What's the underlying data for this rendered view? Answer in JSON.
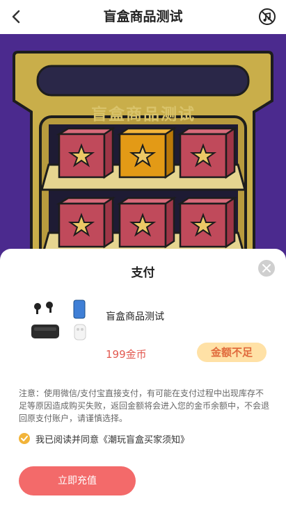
{
  "header": {
    "title": "盲盒商品测试",
    "back_icon": "chevron-left-icon",
    "music_icon": "music-off-icon"
  },
  "scene": {
    "sign_text": "盲盒商品测试",
    "colors": {
      "background": "#4b2a8e",
      "cabinet": "#c9ae4a",
      "box_pink": "#c04a5b",
      "box_orange": "#e39a16"
    }
  },
  "modal": {
    "title": "支付",
    "close_icon": "close-icon",
    "product": {
      "name": "盲盒商品测试",
      "price": "199金币",
      "status": "金额不足"
    },
    "notice": "注意：使用微信/支付宝直接支付，有可能在支付过程中出现库存不足等原因造成购买失败，返回金额将会进入您的金币余额中，不会退回原支付账户，请谨慎选择。",
    "agreement": "我已阅读并同意《潮玩盲盒买家须知》",
    "recharge_button": "立即充值"
  }
}
